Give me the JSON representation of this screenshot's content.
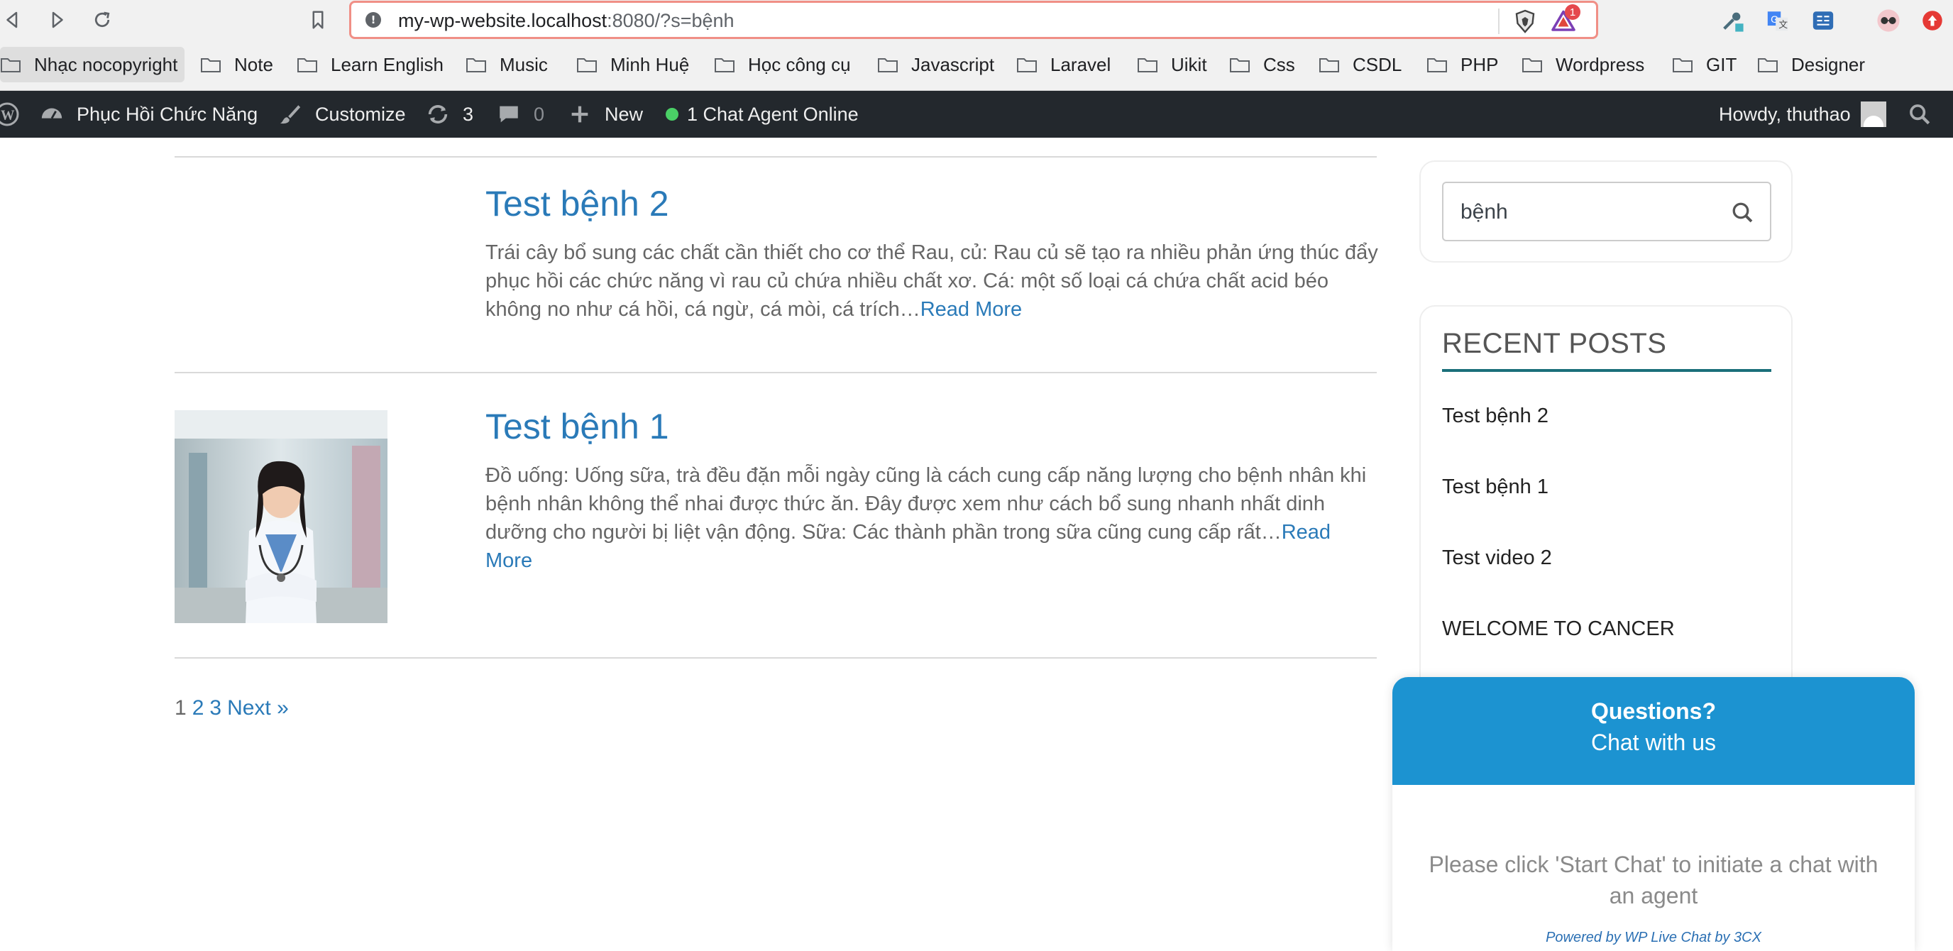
{
  "browser": {
    "url_host": "my-wp-website.localhost",
    "url_rest": ":8080/?s=bệnh",
    "rewards_badge": "1"
  },
  "bookmarks": [
    {
      "label": "Nhạc nocopyright"
    },
    {
      "label": "Note"
    },
    {
      "label": "Learn English"
    },
    {
      "label": "Music"
    },
    {
      "label": "Minh Huệ"
    },
    {
      "label": "Học công cụ"
    },
    {
      "label": "Javascript"
    },
    {
      "label": "Laravel"
    },
    {
      "label": "Uikit"
    },
    {
      "label": "Css"
    },
    {
      "label": "CSDL"
    },
    {
      "label": "PHP"
    },
    {
      "label": "Wordpress"
    },
    {
      "label": "GIT"
    },
    {
      "label": "Designer"
    }
  ],
  "admin_bar": {
    "site_name": "Phục Hồi Chức Năng",
    "customize": "Customize",
    "updates_count": "3",
    "comments_count": "0",
    "new_label": "New",
    "chat_status": "1 Chat Agent Online",
    "howdy": "Howdy, thuthao"
  },
  "posts": [
    {
      "title": "Test bệnh 2",
      "excerpt": "Trái cây bổ sung các chất cần thiết cho cơ thể Rau, củ: Rau củ sẽ tạo ra nhiều phản ứng thúc đẩy phục hồi các chức năng vì rau củ chứa nhiều chất xơ. Cá: một số loại cá chứa chất acid béo không no như cá hồi, cá ngừ, cá mòi, cá trích…",
      "read_more": "Read More"
    },
    {
      "title": "Test bệnh 1",
      "excerpt": "Đồ uống: Uống sữa, trà đều đặn mỗi ngày cũng là cách cung cấp năng lượng cho bệnh nhân khi bệnh nhân không thể nhai được thức ăn. Đây được xem như cách bổ sung nhanh nhất dinh dưỡng cho người bị liệt vận động. Sữa: Các thành phần trong sữa cũng cung cấp rất…",
      "read_more": "Read More"
    }
  ],
  "pagination": {
    "pages": [
      "1",
      "2",
      "3"
    ],
    "next": "Next »"
  },
  "sidebar": {
    "search_value": "bệnh",
    "recent_title": "RECENT POSTS",
    "recent_posts": [
      "Test bệnh 2",
      "Test bệnh 1",
      "Test video 2",
      "WELCOME TO CANCER"
    ]
  },
  "chat": {
    "question": "Questions?",
    "subtitle": "Chat with us",
    "body": "Please click 'Start Chat' to initiate a chat with an agent",
    "powered": "Powered by WP Live Chat by 3CX"
  },
  "colors": {
    "link": "#2a7ab8",
    "admin_bar": "#23282d",
    "chat_header": "#1c93d1",
    "widget_accent": "#1a6f7a"
  }
}
